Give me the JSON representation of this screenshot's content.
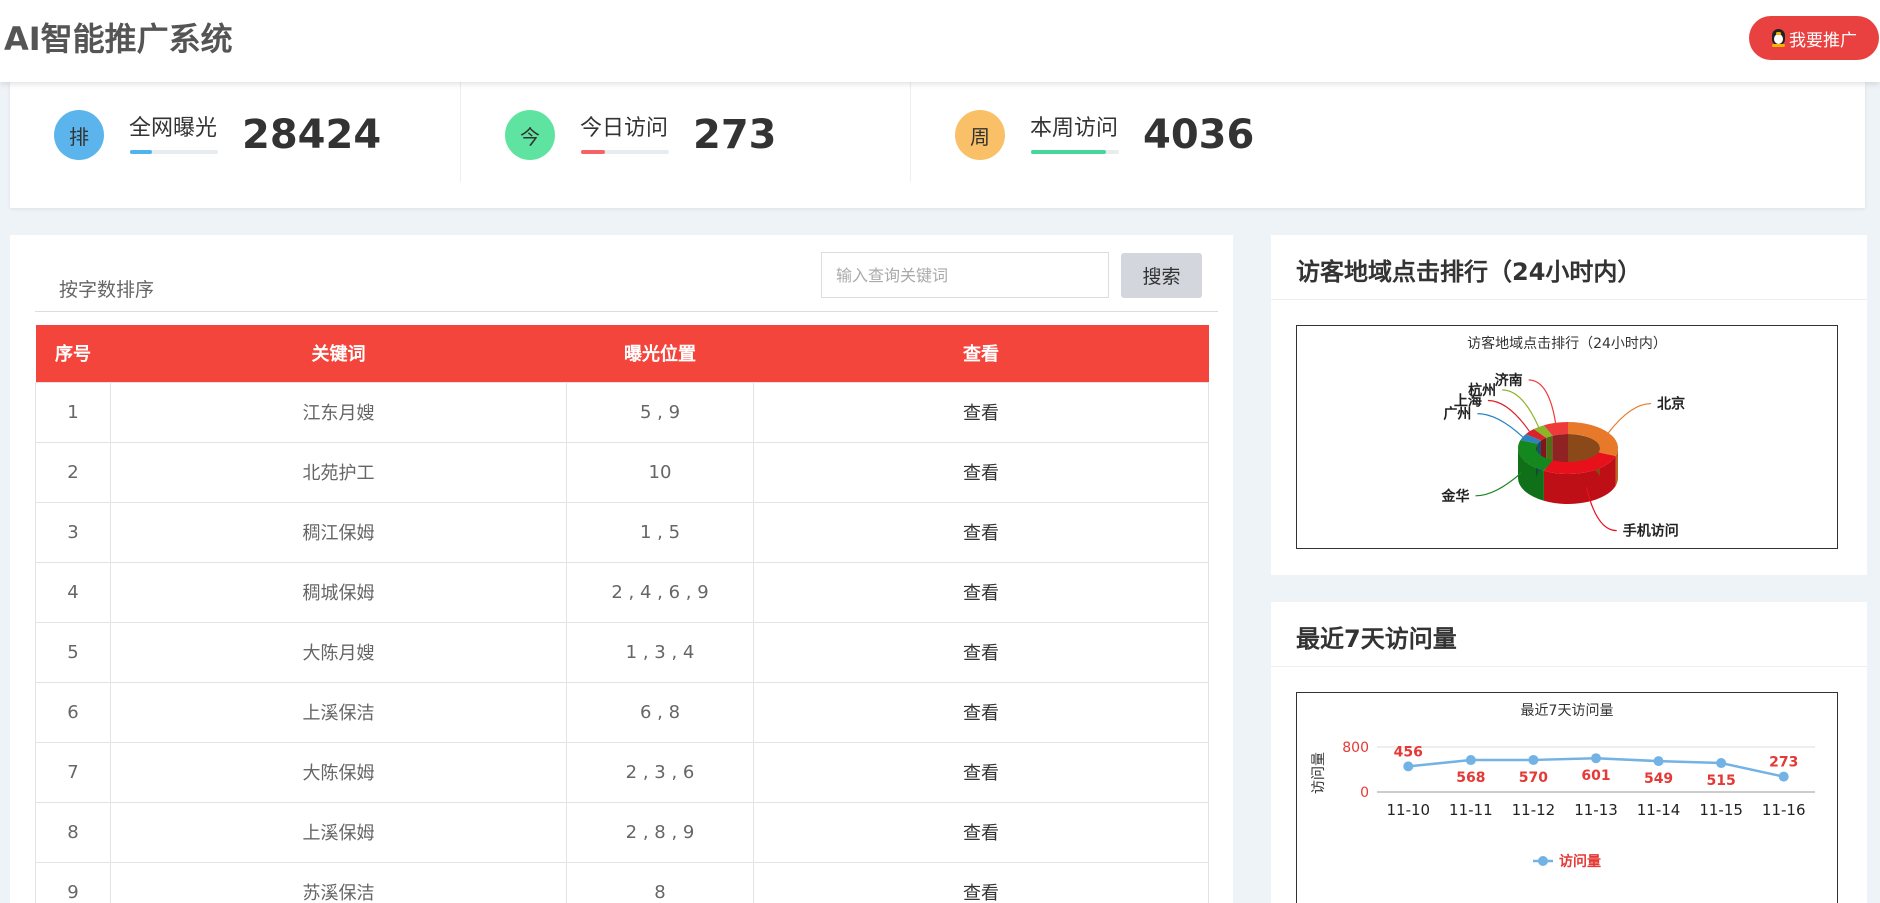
{
  "header": {
    "title": "AI智能推广系统",
    "promo_label": "我要推广"
  },
  "stats": [
    {
      "icon": "排",
      "label": "全网曝光",
      "value": "28424",
      "color": "#5bb4ec",
      "bar_color": "#4fb3ee",
      "bar_fraction": 0.25
    },
    {
      "icon": "今",
      "label": "今日访问",
      "value": "273",
      "color": "#5fe3a1",
      "bar_color": "#f46464",
      "bar_fraction": 0.27
    },
    {
      "icon": "周",
      "label": "本周访问",
      "value": "4036",
      "color": "#f9c068",
      "bar_color": "#45d69b",
      "bar_fraction": 0.85
    }
  ],
  "keywords_panel": {
    "sort_label": "按字数排序",
    "search_placeholder": "输入查询关键词",
    "search_button": "搜索",
    "columns": [
      "序号",
      "关键词",
      "曝光位置",
      "查看"
    ],
    "rows": [
      [
        "1",
        "江东月嫂",
        "5 , 9",
        "查看"
      ],
      [
        "2",
        "北苑护工",
        "10",
        "查看"
      ],
      [
        "3",
        "稠江保姆",
        "1 , 5",
        "查看"
      ],
      [
        "4",
        "稠城保姆",
        "2 , 4 , 6 , 9",
        "查看"
      ],
      [
        "5",
        "大陈月嫂",
        "1 , 3 , 4",
        "查看"
      ],
      [
        "6",
        "上溪保洁",
        "6 , 8",
        "查看"
      ],
      [
        "7",
        "大陈保姆",
        "2 , 3 , 6",
        "查看"
      ],
      [
        "8",
        "上溪保姆",
        "2 , 8 , 9",
        "查看"
      ],
      [
        "9",
        "苏溪保洁",
        "8",
        "查看"
      ]
    ]
  },
  "region_panel": {
    "title": "访客地域点击排行（24小时内）",
    "chart_title": "访客地域点击排行（24小时内）"
  },
  "visits_panel": {
    "title": "最近7天访问量",
    "chart_title": "最近7天访问量"
  },
  "chart_data": [
    {
      "type": "pie",
      "title": "访客地域点击排行（24小时内）",
      "categories": [
        "北京",
        "手机访问",
        "金华",
        "广州",
        "上海",
        "杭州",
        "济南"
      ],
      "values": [
        30,
        28,
        22,
        4,
        4,
        4,
        8
      ],
      "colors": [
        "#e8792b",
        "#e8111b",
        "#14871e",
        "#2a84c4",
        "#d8232b",
        "#8bb52a",
        "#ef3a3a"
      ]
    },
    {
      "type": "line",
      "title": "最近7天访问量",
      "ylabel": "访问量",
      "categories": [
        "11-10",
        "11-11",
        "11-12",
        "11-13",
        "11-14",
        "11-15",
        "11-16"
      ],
      "series": [
        {
          "name": "访问量",
          "values": [
            456,
            568,
            570,
            601,
            549,
            515,
            273
          ]
        }
      ],
      "yticks": [
        0,
        800
      ],
      "ylim": [
        0,
        800
      ],
      "line_color": "#73b2e4",
      "label_color": "#e53935"
    }
  ]
}
